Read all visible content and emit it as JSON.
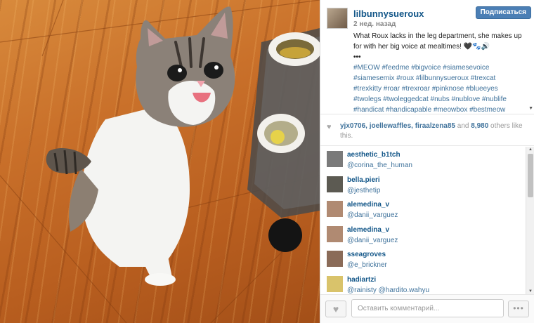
{
  "post": {
    "username": "lilbunnysueroux",
    "timestamp": "2 нед. назад",
    "follow_label": "Подписаться",
    "caption_text": "What Roux lacks in the leg department, she makes up for with her big voice at mealtimes! 🖤🐾🔊",
    "caption_ellipsis": "•••",
    "hashtags": "#MEOW #feedme #bigvoice #siamesevoice #siamesemix #roux #lilbunnysueroux #trexcat #trexkitty #roar #trexroar #pinknose #blueeyes #twolegs #twoleggedcat #nubs #nublove #nublife #handicat #handicapable #meowbox #bestmeow"
  },
  "likes": {
    "users": "yjx0706, joellewaffles, firaalzena85",
    "and": "and",
    "count": "8,980",
    "rest": "others like this."
  },
  "comments": [
    {
      "user": "aesthetic_b1tch",
      "text": "@corina_the_human",
      "avatar_color": "#7a7a7a"
    },
    {
      "user": "bella.pieri",
      "text": "@jesthetip",
      "avatar_color": "#5c5a52"
    },
    {
      "user": "alemedina_v",
      "text": "@danii_varguez",
      "avatar_color": "#b08a72"
    },
    {
      "user": "alemedina_v",
      "text": "@danii_varguez",
      "avatar_color": "#b08a72"
    },
    {
      "user": "sseagroves",
      "text": "@e_brickner",
      "avatar_color": "#8a6b58"
    },
    {
      "user": "hadiartzi",
      "text": "@rainisty @hardito.wahyu",
      "avatar_color": "#d9c36b"
    }
  ],
  "footer": {
    "comment_placeholder": "Оставить комментарий...",
    "more_label": "•••"
  },
  "colors": {
    "link": "#125688",
    "hashtag": "#3f729b",
    "follow_button": "#4b7fb5"
  }
}
